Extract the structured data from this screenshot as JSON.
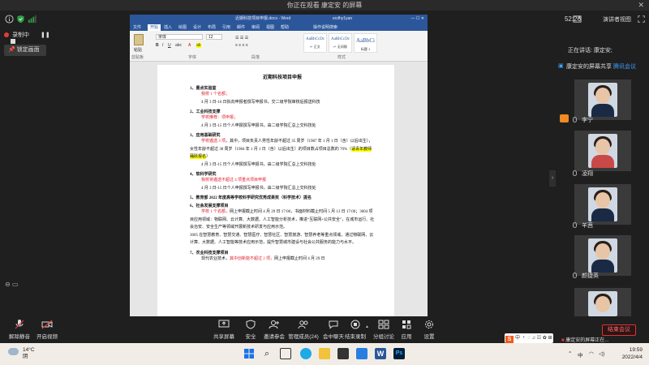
{
  "banner": {
    "text": "你正在观看 康定安 的屏幕"
  },
  "topbar": {
    "time": "52:26",
    "view_label": "演讲者视图"
  },
  "recording": {
    "label": "录制中"
  },
  "lock_button": {
    "label": "锁定画面"
  },
  "word": {
    "title": "近期科技项目申报.docx  -  Word",
    "user": "ecdhy1yan",
    "tabs": [
      "文件",
      "开始",
      "插入",
      "绘图",
      "设计",
      "布局",
      "引用",
      "邮件",
      "审阅",
      "视图",
      "帮助",
      "操作说明搜索"
    ],
    "active_tab": "开始",
    "ribbon": {
      "clipboard": "粘贴",
      "clipboard_group": "剪贴板",
      "font_name": "宋体",
      "font_size": "12",
      "font_group": "字体",
      "para_group": "段落",
      "styles_group": "样式",
      "styles": [
        {
          "sample": "AaBbCcDc",
          "name": "↵ 正文"
        },
        {
          "sample": "AaBbCcDc",
          "name": "↵ 无间隔"
        },
        {
          "sample": "AaBbCi",
          "name": "标题 1"
        }
      ]
    }
  },
  "document": {
    "title": "近期科技项目申报",
    "sections": [
      {
        "heading": "1、重点实验室",
        "lines": [
          {
            "text": "我校 1 个名额；",
            "red": true
          },
          {
            "text": "4 月 3 日-16 日拟向申报者撰写申报书，交二级学院审核后报送科技"
          }
        ]
      },
      {
        "heading": "2、工业科技支撑",
        "lines": [
          {
            "text": "学校推荐：项申报；",
            "red": true
          },
          {
            "text": "4 月 3 日-15 日个人申报撰写申报书，由二级学院汇总上交科技处"
          }
        ]
      },
      {
        "heading": "3、应用基础研究",
        "lines": [
          {
            "text": "学校遴选 3 项，其中，项目负责人男性年龄不超过 35 周岁（1987 年 1 月 1 日（含）以后出生），女性年龄不超过 38 周岁（1984 年 1 月 1 日（含）以后出生）的项目数占项目总数的 70%（请青年教师踊跃报名）",
            "wrap": true,
            "mixed": true
          },
          {
            "text": "4 月 3 日-15 日个人申报撰写申报书，由二级学院汇总上交科技处"
          }
        ]
      },
      {
        "heading": "4、软科学研究",
        "lines": [
          {
            "text": "我校将遴选不超过 4 项重点项目申报",
            "red": true
          },
          {
            "text": "4 月 3 日-15 日个人申报撰写申报书，由二级学院汇总上交科技处"
          }
        ]
      },
      {
        "heading": "5、教育部 2022 年度高等学校科学研究优秀成果奖（科学技术）提名",
        "lines": []
      },
      {
        "heading": "6、社会发展支撑项目",
        "lines": [
          {
            "text": "学校 1 个名额，网上申报截止时间 4 月 29 日 17:00，书面材料截止时间 5 月 13 日 17:00；3004 项目应用领域：物联网、云计算、大数据、人工智能分析技术，推进“互联网+公共安全”，在城市运行、社会治安、安全生产等领域开展新技术研发与应用示范。",
            "wrap": true,
            "partred": true
          },
          {
            "text": "3005 在智慧教育、智慧交通、智慧医疗、智慧社区、智慧旅游、智慧养老等重点领域，通过物联网、云计算、大数据、人工智能等技术应用示范，提升智慧城市建设与社会公共服务的能力与水平。",
            "wrap": true,
            "noindent": true
          }
        ]
      },
      {
        "heading": "7、农业科技支撑项目",
        "lines": [
          {
            "text": "现代农业技术，其中创新能不超过 2 项，网上申报截止时间 4 月 29 日",
            "partred2": true
          }
        ]
      }
    ],
    "highlight": "请青年教师踊跃报名",
    "red_frag1": "学校 1 个名额，",
    "red_frag2": "其中创新能不超过 2 项，"
  },
  "panel": {
    "speaking": "正在讲话: 康定安;",
    "sharing": "康定安的屏幕共享",
    "sharing_tail": "腾讯会议",
    "participants": [
      "李宁",
      "凌翔",
      "羊茜",
      "颜捷英",
      ""
    ]
  },
  "toolbar": {
    "left": [
      {
        "label": "解除静音"
      },
      {
        "label": "开启视频"
      }
    ],
    "center": [
      {
        "label": "共享屏幕"
      },
      {
        "label": "安全"
      },
      {
        "label": "邀请参会"
      },
      {
        "label": "管理成员(24)"
      },
      {
        "label": "会中聊天"
      },
      {
        "label": "结束录制"
      },
      {
        "label": "分组讨论"
      },
      {
        "label": "应用"
      },
      {
        "label": "设置"
      }
    ],
    "end": "结束会议"
  },
  "ime": {
    "text": "中 ・ ◌ ♫ ☷ ✿ ⊞"
  },
  "tip": {
    "text": "康定安的屏幕正在..."
  },
  "taskbar": {
    "temp": "14°C",
    "weather": "阴",
    "time": "19:59",
    "date": "2022/4/4",
    "lang": "中"
  },
  "colors": {
    "word_blue": "#2b579a",
    "red_text": "#e2202a",
    "highlight": "#ffff00",
    "end_red": "#ff6a6a"
  }
}
